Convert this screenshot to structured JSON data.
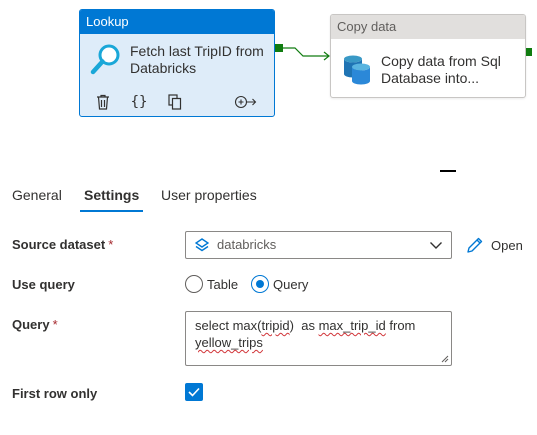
{
  "canvas": {
    "lookup_activity": {
      "type_label": "Lookup",
      "title": "Fetch last TripID from Databricks",
      "icon": "magnifier-icon",
      "toolbar": [
        "delete-icon",
        "code-braces-icon",
        "copy-icon",
        "add-output-icon"
      ]
    },
    "copy_activity": {
      "type_label": "Copy data",
      "title": "Copy data from Sql Database into...",
      "icon": "database-icon"
    },
    "connector_color": "#107c10",
    "accent_color": "#0078d4"
  },
  "tabs": [
    {
      "label": "General",
      "active": false
    },
    {
      "label": "Settings",
      "active": true
    },
    {
      "label": "User properties",
      "active": false
    }
  ],
  "settings": {
    "source_dataset": {
      "label": "Source dataset",
      "required_marker": "*",
      "value": "databricks",
      "icon": "databricks-icon",
      "open_label": "Open"
    },
    "use_query": {
      "label": "Use query",
      "options": [
        {
          "label": "Table",
          "selected": false
        },
        {
          "label": "Query",
          "selected": true
        }
      ]
    },
    "query": {
      "label": "Query",
      "required_marker": "*",
      "text_parts": [
        "select max(",
        "tripid",
        ")  as ",
        "max_trip_id",
        " from ",
        "yellow_trips"
      ]
    },
    "first_row_only": {
      "label": "First row only",
      "checked": true
    }
  }
}
